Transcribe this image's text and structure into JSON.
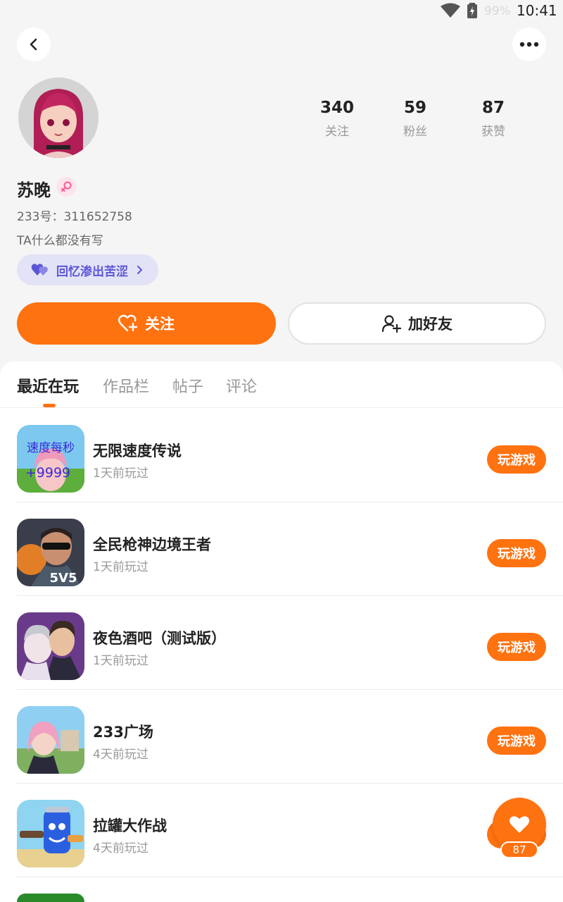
{
  "status_bar": {
    "battery": "99%",
    "time": "10:41"
  },
  "profile": {
    "name": "苏晚",
    "uid": "233号：311652758",
    "bio": "TA什么都没有写",
    "mood_tag": "回忆渗出苦涩",
    "stats": [
      {
        "value": "340",
        "label": "关注"
      },
      {
        "value": "59",
        "label": "粉丝"
      },
      {
        "value": "87",
        "label": "获赞"
      }
    ]
  },
  "actions": {
    "follow": "关注",
    "add_friend": "加好友"
  },
  "tabs": [
    {
      "label": "最近在玩",
      "active": true
    },
    {
      "label": "作品栏",
      "active": false
    },
    {
      "label": "帖子",
      "active": false
    },
    {
      "label": "评论",
      "active": false
    }
  ],
  "games": [
    {
      "title": "无限速度传说",
      "played": "1天前玩过",
      "button": "玩游戏",
      "icon": "speed-legend-icon",
      "icon_text_1": "速度每秒",
      "icon_text_2": "+9999"
    },
    {
      "title": "全民枪神边境王者",
      "played": "1天前玩过",
      "button": "玩游戏",
      "icon": "gunner-icon",
      "icon_text_1": "5V5"
    },
    {
      "title": "夜色酒吧（测试版）",
      "played": "1天前玩过",
      "button": "玩游戏",
      "icon": "night-bar-icon"
    },
    {
      "title": "233广场",
      "played": "4天前玩过",
      "button": "玩游戏",
      "icon": "plaza-icon"
    },
    {
      "title": "拉罐大作战",
      "played": "4天前玩过",
      "button": "玩游戏",
      "icon": "can-battle-icon"
    }
  ],
  "fab": {
    "count": "87"
  },
  "colors": {
    "accent": "#ff7210",
    "mood": "#5b56d6"
  }
}
